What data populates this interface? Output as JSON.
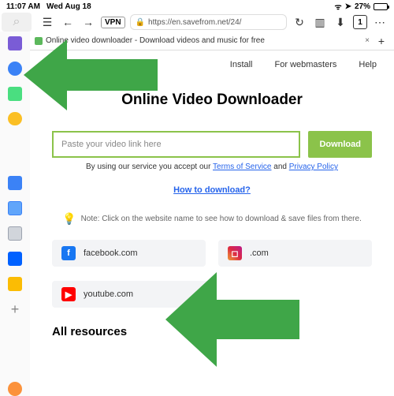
{
  "status": {
    "time": "11:07 AM",
    "date": "Wed Aug 18",
    "battery": "27%"
  },
  "toolbar": {
    "vpn": "VPN",
    "url": "https://en.savefrom.net/24/",
    "tab_count": "1"
  },
  "tab": {
    "title": "Online video downloader - Download videos and music for free"
  },
  "nav": {
    "install": "Install",
    "webmasters": "For webmasters",
    "help": "Help"
  },
  "page": {
    "title": "Online Video Downloader",
    "placeholder": "Paste your video link here",
    "download": "Download",
    "terms_pre": "By using our service you accept our ",
    "terms_link": "Terms of Service",
    "terms_mid": " and ",
    "privacy_link": "Privacy Policy",
    "howto": "How to download?",
    "note": "Note: Click on the website name to see how to download & save files from there.",
    "all_resources": "All resources"
  },
  "sites": {
    "fb": "facebook.com",
    "ig": ".com",
    "yt": "youtube.com"
  }
}
